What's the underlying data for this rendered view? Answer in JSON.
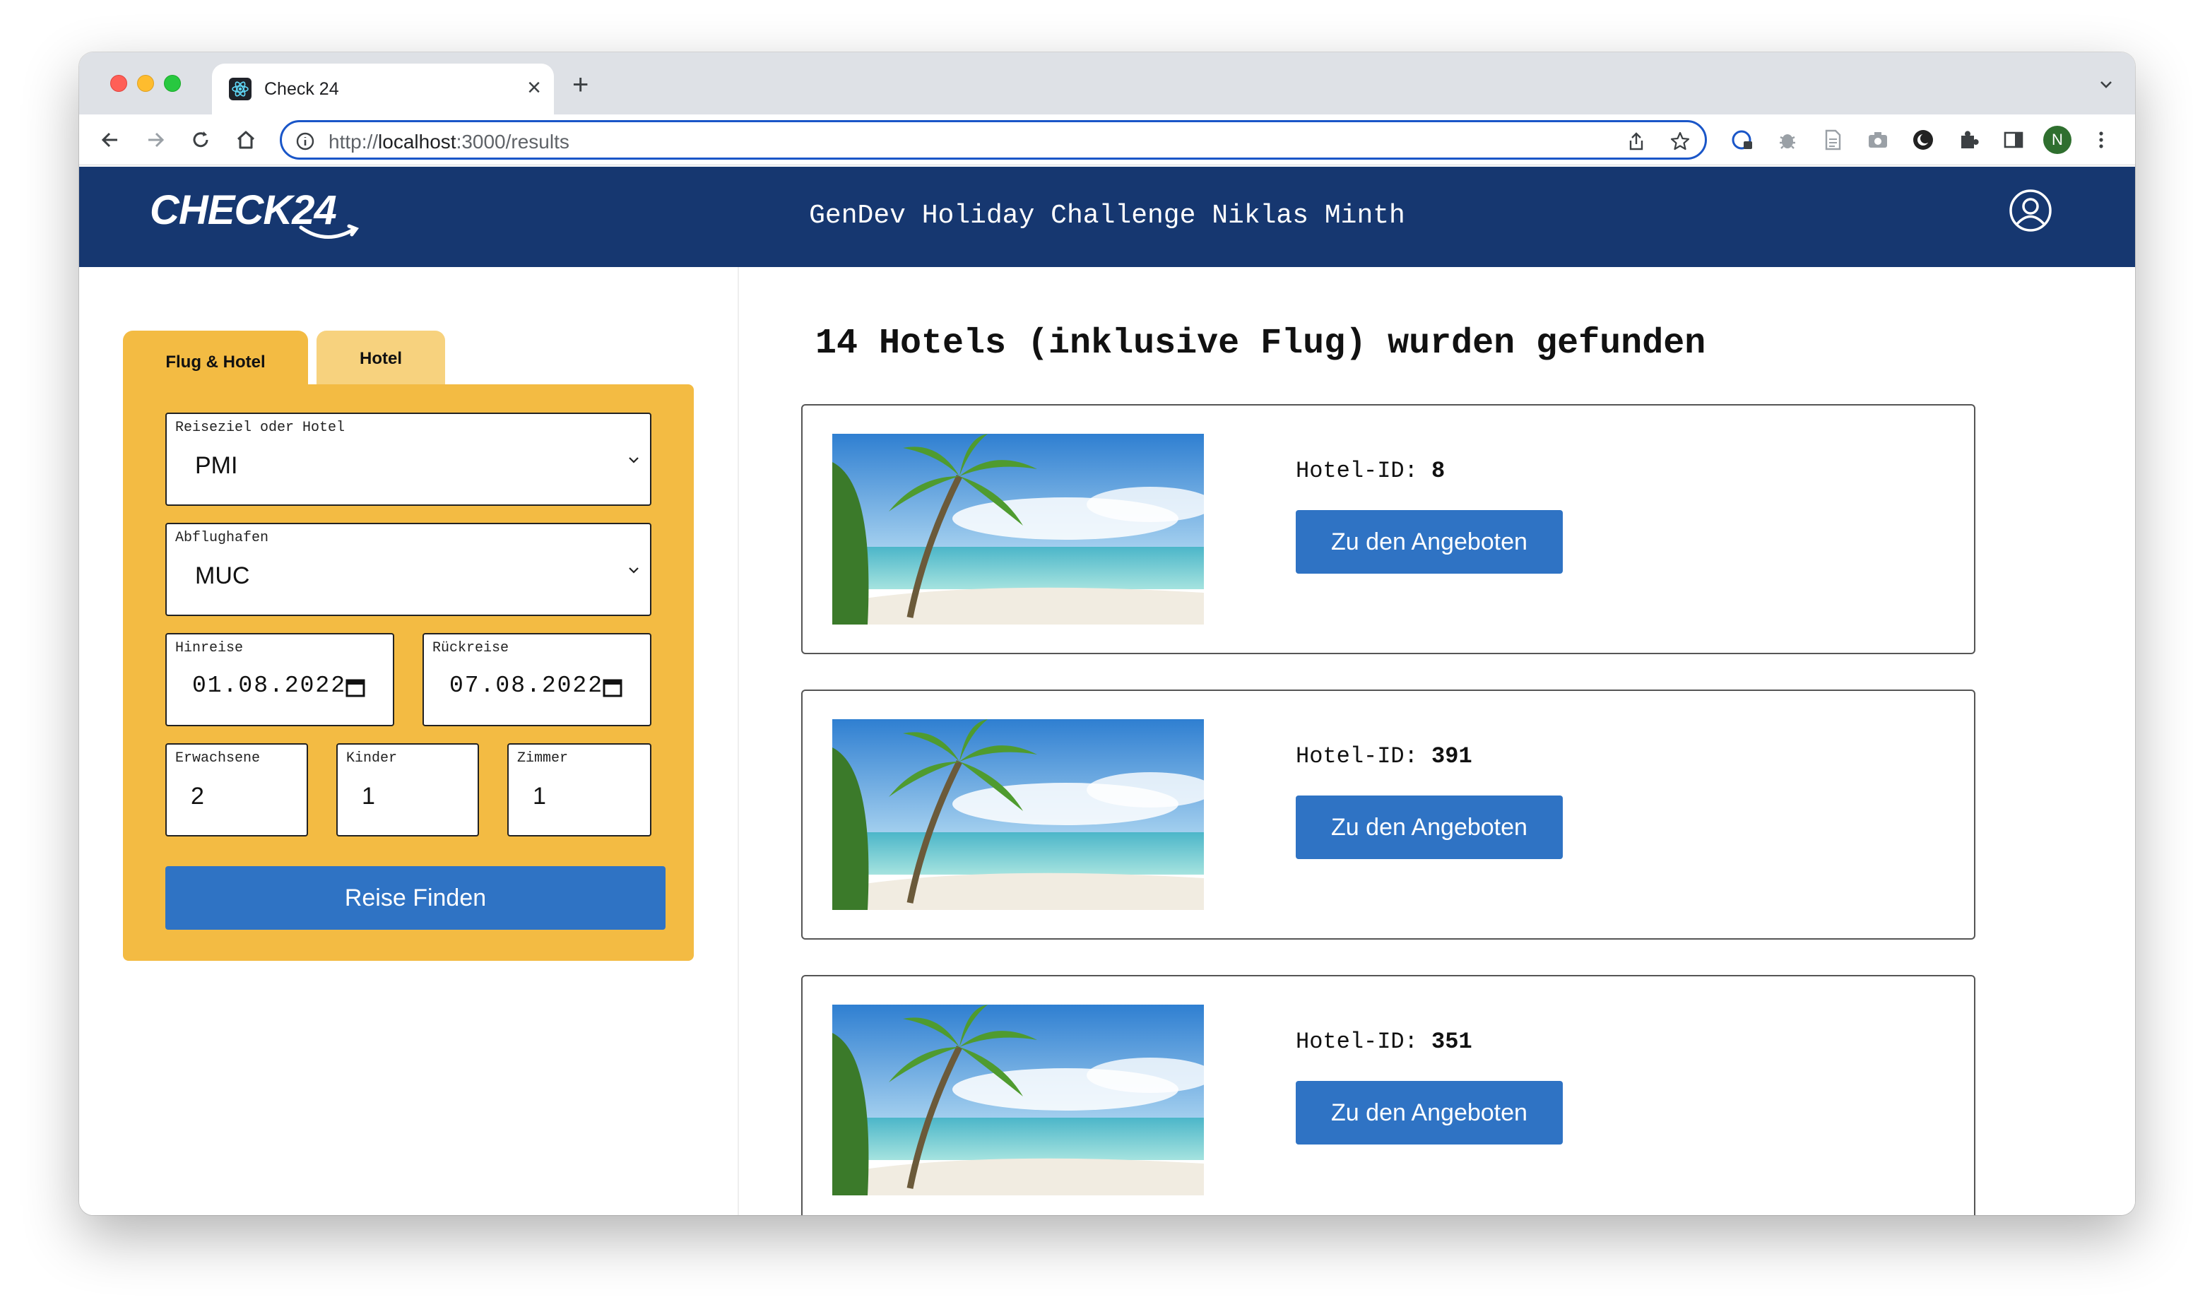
{
  "browser": {
    "tab_title": "Check 24",
    "new_tab_symbol": "+",
    "close_symbol": "×",
    "url_prefix": "http://",
    "url_host": "localhost",
    "url_path": ":3000/results",
    "profile_initial": "N"
  },
  "header": {
    "logo_text": "CHECK24",
    "title": "GenDev Holiday Challenge Niklas Minth"
  },
  "search": {
    "tabs": [
      {
        "label": "Flug & Hotel",
        "active": true
      },
      {
        "label": "Hotel",
        "active": false
      }
    ],
    "destination": {
      "label": "Reiseziel oder Hotel",
      "value": "PMI"
    },
    "departure_airport": {
      "label": "Abflughafen",
      "value": "MUC"
    },
    "outbound": {
      "label": "Hinreise",
      "value": "01.08.2022"
    },
    "return": {
      "label": "Rückreise",
      "value": "07.08.2022"
    },
    "adults": {
      "label": "Erwachsene",
      "value": "2"
    },
    "children": {
      "label": "Kinder",
      "value": "1"
    },
    "rooms": {
      "label": "Zimmer",
      "value": "1"
    },
    "submit_label": "Reise Finden"
  },
  "results": {
    "title": "14 Hotels (inklusive Flug) wurden gefunden",
    "hotel_id_label": "Hotel-ID:",
    "offers_label": "Zu den Angeboten",
    "hotels": [
      {
        "id": "8"
      },
      {
        "id": "391"
      },
      {
        "id": "351"
      }
    ]
  },
  "colors": {
    "header_bg": "#163770",
    "panel_bg": "#f3bb43",
    "button_bg": "#2f73c4"
  }
}
